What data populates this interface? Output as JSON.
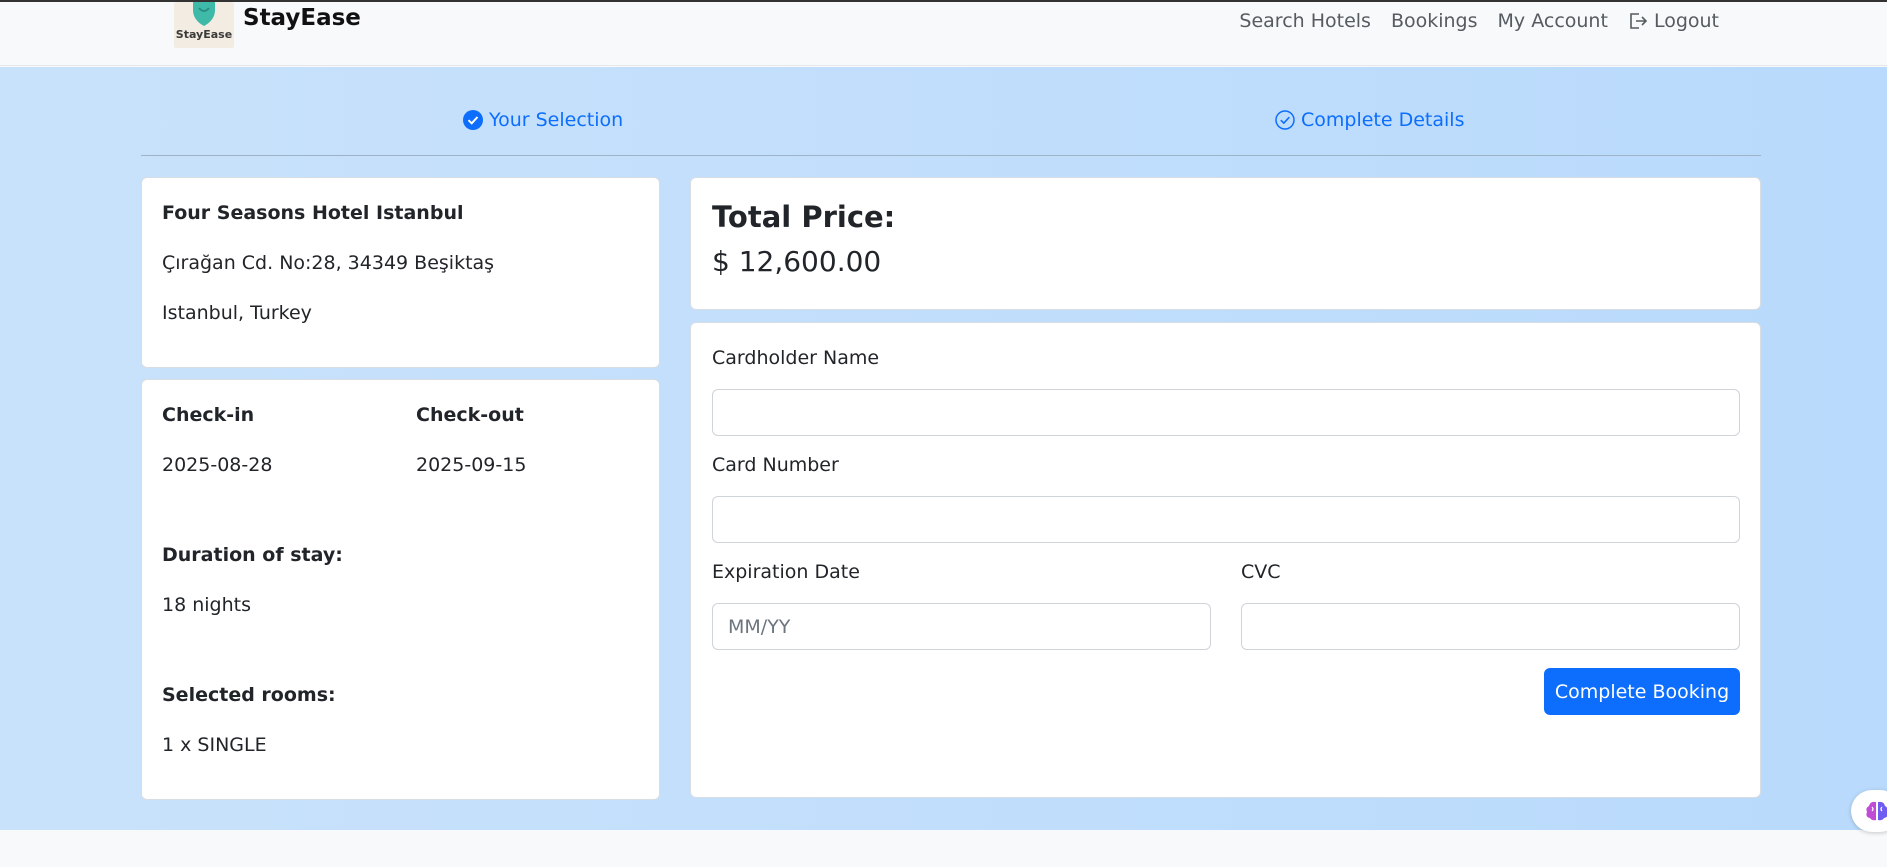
{
  "brand": {
    "logo_text": "StayEase",
    "name": "StayEase"
  },
  "nav": {
    "search_hotels": "Search Hotels",
    "bookings": "Bookings",
    "my_account": "My Account",
    "logout": "Logout"
  },
  "steps": {
    "selection": {
      "label": "Your Selection",
      "icon": "check-circle-fill-icon",
      "state": "completed"
    },
    "details": {
      "label": "Complete Details",
      "icon": "check-circle-outline-icon",
      "state": "current"
    }
  },
  "hotel": {
    "name": "Four Seasons Hotel Istanbul",
    "address_line1": "Çırağan Cd. No:28, 34349 Beşiktaş",
    "address_line2": "Istanbul, Turkey"
  },
  "stay": {
    "checkin_label": "Check-in",
    "checkin_value": "2025-08-28",
    "checkout_label": "Check-out",
    "checkout_value": "2025-09-15",
    "duration_label": "Duration of stay:",
    "duration_value": "18 nights",
    "rooms_label": "Selected rooms:",
    "rooms_value": "1 x SINGLE"
  },
  "price": {
    "label": "Total Price:",
    "value": "$ 12,600.00"
  },
  "payment": {
    "cardholder_label": "Cardholder Name",
    "cardholder_value": "",
    "card_number_label": "Card Number",
    "card_number_value": "",
    "expiration_label": "Expiration Date",
    "expiration_placeholder": "MM/YY",
    "cvc_label": "CVC",
    "cvc_value": "",
    "submit_label": "Complete Booking"
  },
  "colors": {
    "primary": "#0d6efd",
    "page_bg_start": "#c9e2fb",
    "page_bg_end": "#b9dafc",
    "navbar_bg": "#f8f9fa"
  }
}
